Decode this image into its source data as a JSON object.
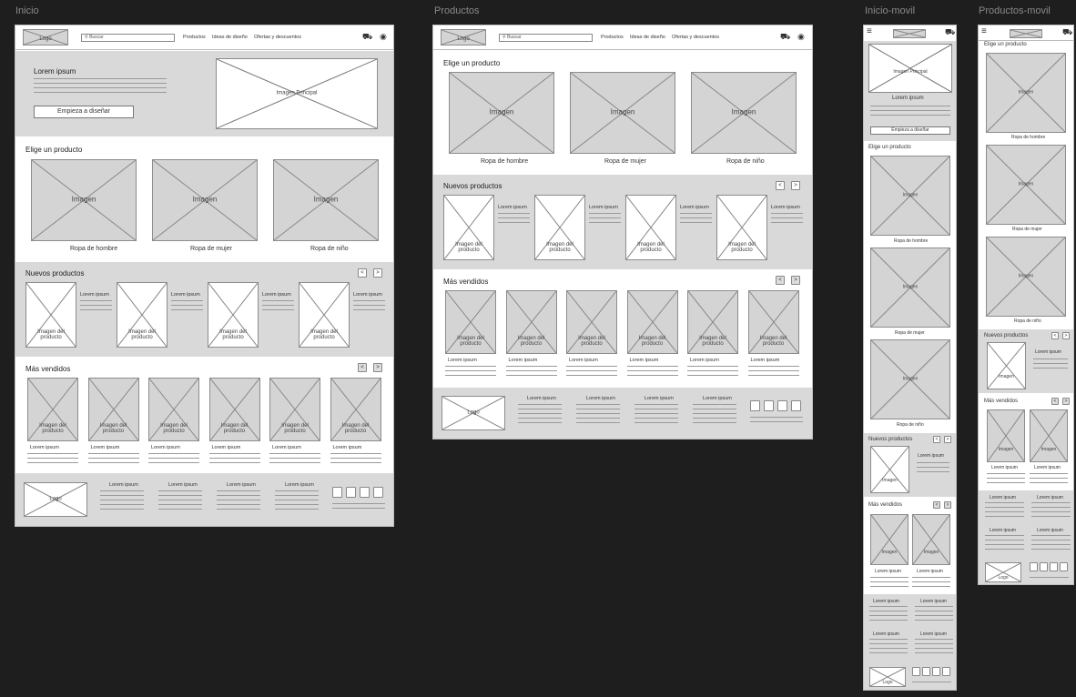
{
  "frames": {
    "inicio": "Inicio",
    "productos": "Productos",
    "inicio_movil": "Inicio-movil",
    "productos_movil": "Productos-movil"
  },
  "header": {
    "logo": "Logo",
    "search_placeholder": "Buscar",
    "nav": [
      "Productos",
      "Ideas de diseño",
      "Ofertas y descuentos"
    ]
  },
  "hero": {
    "title": "Lorem ipsum",
    "button": "Empieza a diseñar",
    "image": "Imagen Principal"
  },
  "sections": {
    "elige": "Elige un producto",
    "nuevos": "Nuevos productos",
    "mas_vendidos": "Más vendidos"
  },
  "categories": [
    "Ropa de hombre",
    "Ropa de mujer",
    "Ropa de niño"
  ],
  "image_label": "Imagen",
  "product_image_label": "Imagen del producto",
  "lorem": "Lorem ipsum",
  "arrows": {
    "prev": "<",
    "next": ">"
  }
}
